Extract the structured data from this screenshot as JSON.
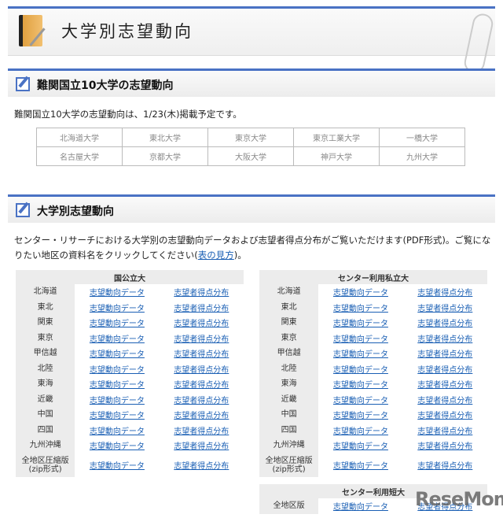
{
  "header": {
    "title": "大学別志望動向"
  },
  "section1": {
    "title": "難関国立10大学の志望動向",
    "notice": "難関国立10大学の志望動向は、1/23(木)掲載予定です。",
    "universities": [
      [
        "北海道大学",
        "東北大学",
        "東京大学",
        "東京工業大学",
        "一橋大学"
      ],
      [
        "名古屋大学",
        "京都大学",
        "大阪大学",
        "神戸大学",
        "九州大学"
      ]
    ]
  },
  "section2": {
    "title": "大学別志望動向",
    "intro": "センター・リサーチにおける大学別の志望動向データおよび志望者得点分布がご覧いただけます(PDF形式)。ご覧になりたい地区の資料名をクリックしてください(",
    "intro_link": "表の見方",
    "intro_end": ")。",
    "link1": "志望動向データ",
    "link2": "志望者得点分布",
    "regions": [
      "北海道",
      "東北",
      "関東",
      "東京",
      "甲信越",
      "北陸",
      "東海",
      "近畿",
      "中国",
      "四国",
      "九州沖縄",
      "全地区圧縮版\n(zip形式)"
    ],
    "tables": [
      {
        "title": "国公立大"
      },
      {
        "title": "センター利用私立大"
      }
    ],
    "junior": {
      "title": "センター利用短大",
      "region": "全地区版"
    }
  },
  "logo": "ReseMom"
}
